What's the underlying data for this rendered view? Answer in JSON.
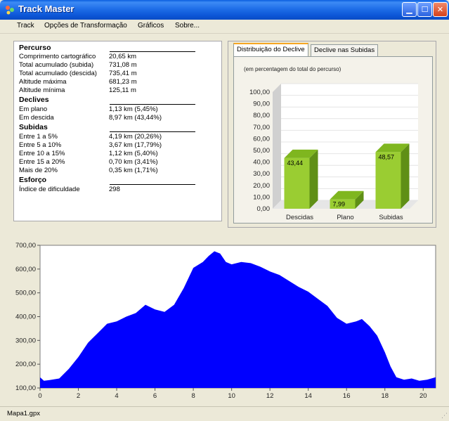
{
  "window": {
    "title": "Track Master",
    "minimize_icon": "minimize-icon",
    "maximize_icon": "maximize-icon",
    "close_icon": "close-icon"
  },
  "menu": [
    "Track",
    "Opções de Transformação",
    "Gráficos",
    "Sobre..."
  ],
  "stats": {
    "percurso": {
      "title": "Percurso",
      "rows": [
        {
          "label": "Comprimento cartográfico",
          "value": "20,65 km"
        },
        {
          "label": "Total acumulado (subida)",
          "value": "731,08 m"
        },
        {
          "label": "Total acumulado (descida)",
          "value": "735,41 m"
        },
        {
          "label": "Altitude máxima",
          "value": "681,23 m"
        },
        {
          "label": "Altitude mínima",
          "value": "125,11 m"
        }
      ]
    },
    "declives": {
      "title": "Declives",
      "rows": [
        {
          "label": "Em plano",
          "value": "1,13 km (5,45%)"
        },
        {
          "label": "Em descida",
          "value": "8,97 km (43,44%)"
        }
      ]
    },
    "subidas": {
      "title": "Subidas",
      "rows": [
        {
          "label": "Entre 1 a 5%",
          "value": "4,19 km (20,26%)"
        },
        {
          "label": "Entre 5 a 10%",
          "value": "3,67 km (17,79%)"
        },
        {
          "label": "Entre 10 a 15%",
          "value": "1,12 km (5,40%)"
        },
        {
          "label": "Entre 15 a 20%",
          "value": "0,70 km (3,41%)"
        },
        {
          "label": "Mais de 20%",
          "value": "0,35 km (1,71%)"
        }
      ]
    },
    "esforco": {
      "title": "Esforço",
      "rows": [
        {
          "label": "Índice de dificuldade",
          "value": "298"
        }
      ]
    }
  },
  "tabs": [
    {
      "label": "Distribuição do Declive",
      "active": true
    },
    {
      "label": "Declive nas Subidas",
      "active": false
    }
  ],
  "chart_data": [
    {
      "type": "bar",
      "subtitle": "(em percentagem do total do percurso)",
      "categories": [
        "Descidas",
        "Plano",
        "Subidas"
      ],
      "values": [
        43.44,
        7.99,
        48.57
      ],
      "value_labels": [
        "43,44",
        "7,99",
        "48,57"
      ],
      "ylim": [
        0,
        100
      ],
      "yticks": [
        "0,00",
        "10,00",
        "20,00",
        "30,00",
        "40,00",
        "50,00",
        "60,00",
        "70,00",
        "80,00",
        "90,00",
        "100,00"
      ],
      "bar_color": "#9acd32",
      "grid": true
    },
    {
      "type": "area",
      "x": [
        0,
        0.2,
        0.5,
        1,
        1.5,
        2,
        2.5,
        3,
        3.5,
        4,
        4.5,
        5,
        5.5,
        6,
        6.5,
        7,
        7.5,
        8,
        8.5,
        8.8,
        9.1,
        9.4,
        9.7,
        10,
        10.5,
        11,
        11.5,
        12,
        12.5,
        13,
        13.5,
        14,
        14.5,
        15,
        15.5,
        16,
        16.5,
        16.8,
        17.2,
        17.6,
        18,
        18.3,
        18.6,
        19,
        19.4,
        19.8,
        20.2,
        20.65
      ],
      "y": [
        145,
        130,
        133,
        140,
        180,
        230,
        290,
        330,
        370,
        380,
        400,
        415,
        450,
        430,
        420,
        450,
        520,
        605,
        630,
        655,
        675,
        665,
        630,
        620,
        630,
        625,
        610,
        590,
        575,
        550,
        525,
        505,
        475,
        445,
        395,
        370,
        380,
        390,
        360,
        320,
        250,
        190,
        145,
        135,
        140,
        130,
        135,
        145
      ],
      "ylim": [
        100,
        700
      ],
      "xlim": [
        0,
        20.65
      ],
      "yticks": [
        "100,00",
        "200,00",
        "300,00",
        "400,00",
        "500,00",
        "600,00",
        "700,00"
      ],
      "xticks": [
        "0",
        "2",
        "4",
        "6",
        "8",
        "10",
        "12",
        "14",
        "16",
        "18",
        "20"
      ],
      "fill_color": "#0000ff",
      "grid": false
    }
  ],
  "statusbar": {
    "file": "Mapa1.gpx"
  }
}
